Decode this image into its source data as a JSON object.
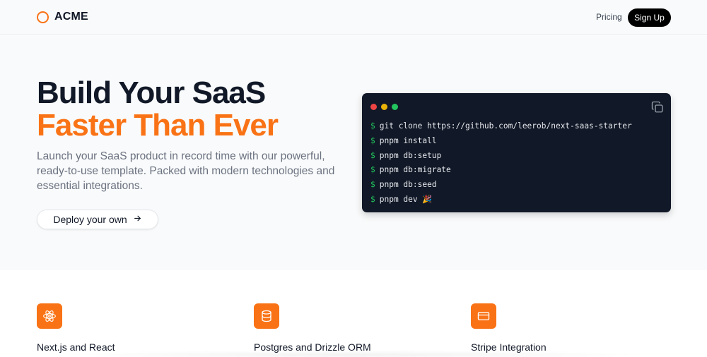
{
  "header": {
    "brand": "ACME",
    "logo_icon": "ring-logo-icon",
    "nav": {
      "pricing_label": "Pricing",
      "signup_label": "Sign Up"
    }
  },
  "hero": {
    "title_line1": "Build Your SaaS",
    "title_line2": "Faster Than Ever",
    "description": "Launch your SaaS product in record time with our powerful, ready-to-use template. Packed with modern technologies and essential integrations.",
    "cta_label": "Deploy your own",
    "cta_icon": "arrow-right-icon"
  },
  "terminal": {
    "copy_icon": "copy-icon",
    "prompt": "$",
    "lines": [
      "git clone https://github.com/leerob/next-saas-starter",
      "pnpm install",
      "pnpm db:setup",
      "pnpm db:migrate",
      "pnpm db:seed",
      "pnpm dev 🎉"
    ]
  },
  "features": [
    {
      "icon": "react-atom-icon",
      "title": "Next.js and React"
    },
    {
      "icon": "database-icon",
      "title": "Postgres and Drizzle ORM"
    },
    {
      "icon": "credit-card-icon",
      "title": "Stripe Integration"
    }
  ],
  "colors": {
    "accent": "#f97316",
    "terminal_bg": "#111827",
    "prompt": "#22c55e",
    "dot_red": "#ef4444",
    "dot_yellow": "#eab308",
    "dot_green": "#22c55e"
  }
}
